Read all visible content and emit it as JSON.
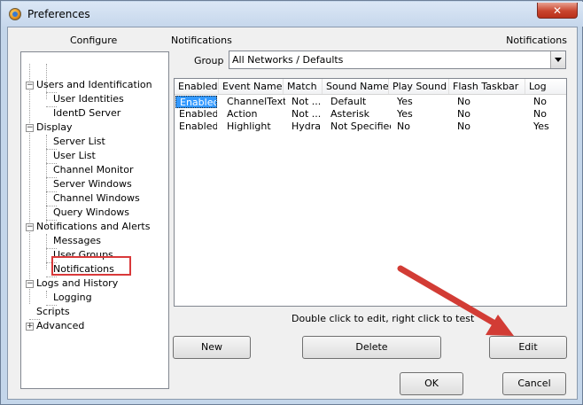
{
  "window": {
    "title": "Preferences",
    "close_glyph": "✕"
  },
  "left": {
    "header": "Configure",
    "tree": [
      {
        "label": "Users and Identification",
        "expander": "−"
      },
      {
        "label": "User Identities"
      },
      {
        "label": "IdentD Server"
      },
      {
        "label": "Display",
        "expander": "−"
      },
      {
        "label": "Server List"
      },
      {
        "label": "User List"
      },
      {
        "label": "Channel Monitor"
      },
      {
        "label": "Server Windows"
      },
      {
        "label": "Channel Windows"
      },
      {
        "label": "Query Windows"
      },
      {
        "label": "Notifications and Alerts",
        "expander": "−"
      },
      {
        "label": "Messages"
      },
      {
        "label": "User Groups"
      },
      {
        "label": "Notifications"
      },
      {
        "label": "Logs and History",
        "expander": "−"
      },
      {
        "label": "Logging"
      },
      {
        "label": "Scripts"
      },
      {
        "label": "Advanced",
        "expander": "+"
      }
    ]
  },
  "right": {
    "header": "Notifications",
    "header_right": "Notifications",
    "group_label": "Group",
    "group_value": "All Networks / Defaults",
    "columns": [
      "Enabled",
      "Event Name",
      "Match",
      "Sound Name",
      "Play Sound",
      "Flash Taskbar",
      "Log"
    ],
    "rows": [
      [
        "Enabled",
        "ChannelText",
        "Not ...",
        "Default",
        "Yes",
        "No",
        "No"
      ],
      [
        "Enabled",
        "Action",
        "Not ...",
        "Asterisk",
        "Yes",
        "No",
        "No"
      ],
      [
        "Enabled",
        "Highlight",
        "Hydra",
        "Not Specified",
        "No",
        "No",
        "Yes"
      ]
    ],
    "hint": "Double click to edit, right click to test",
    "buttons": {
      "new": "New",
      "delete": "Delete",
      "edit": "Edit",
      "ok": "OK",
      "cancel": "Cancel"
    }
  },
  "colors": {
    "highlight_box": "#d9393a",
    "arrow": "#d23c35",
    "selection": "#3399ff"
  }
}
